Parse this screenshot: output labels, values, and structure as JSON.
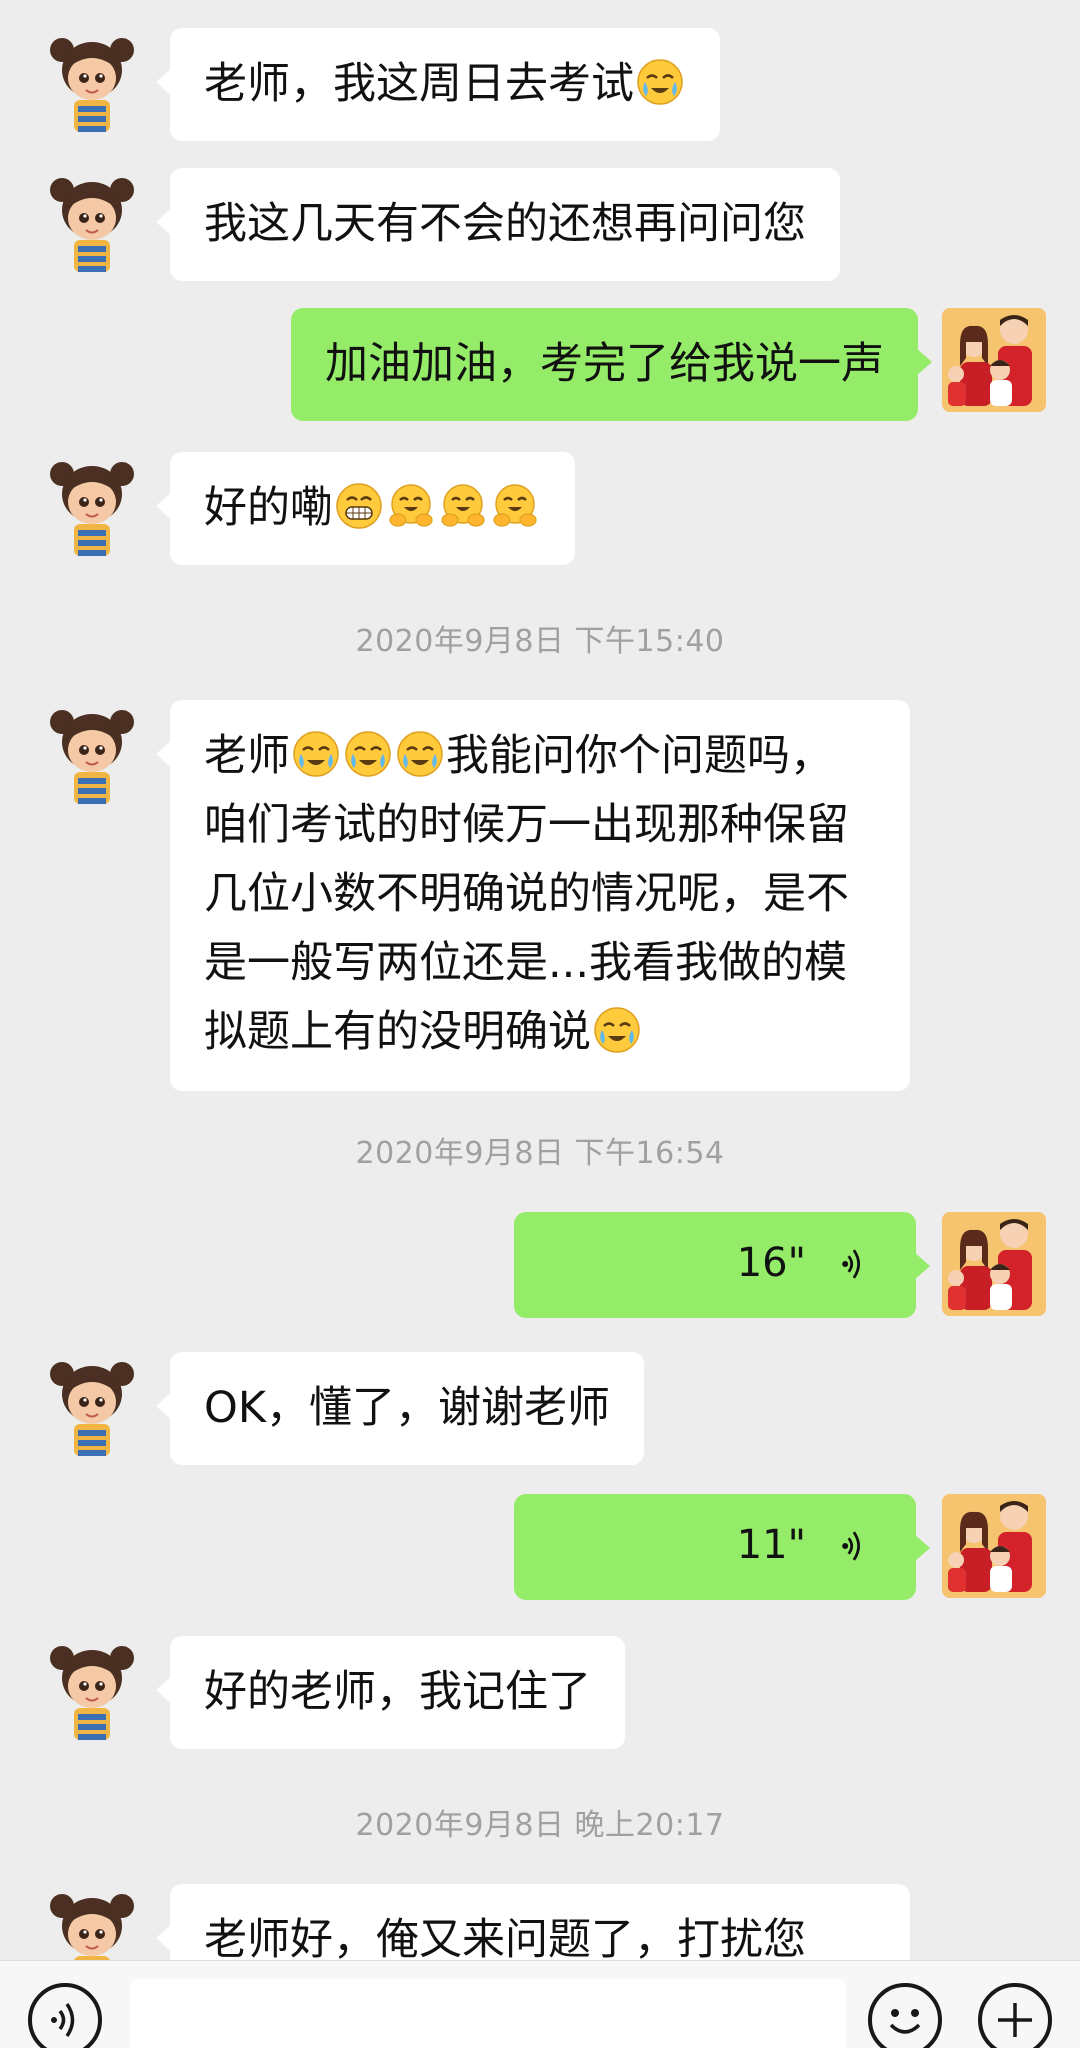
{
  "chat": {
    "messages": [
      {
        "text": "老师，我这周日去考试"
      },
      {
        "text": "我这几天有不会的还想再问问您"
      },
      {
        "text": "加油加油，考完了给我说一声"
      },
      {
        "text": "好的嘞"
      },
      {
        "text_lines": [
          "老师",
          "我能问你个问题吗，",
          "咱们考试的时候万一出现那种保留",
          "几位小数不明确说的情况呢，是不",
          "是一般写两位还是...我看我做的模",
          "拟题上有的没明确说"
        ]
      },
      {
        "duration": "16\""
      },
      {
        "text": "OK，懂了，谢谢老师"
      },
      {
        "duration": "11\""
      },
      {
        "text": "好的老师，我记住了"
      },
      {
        "text": "老师好，俺又来问题了，打扰您"
      }
    ],
    "timestamps": [
      "2020年9月8日 下午15:40",
      "2020年9月8日 下午16:54",
      "2020年9月8日 晚上20:17"
    ]
  },
  "icons": {
    "voice_toggle": "voice-input-icon",
    "emoji": "emoji-icon",
    "more": "plus-icon"
  },
  "colors": {
    "background": "#ededed",
    "sent_bubble": "#95ec69",
    "received_bubble": "#ffffff",
    "timestamp": "#a0a0a0"
  }
}
